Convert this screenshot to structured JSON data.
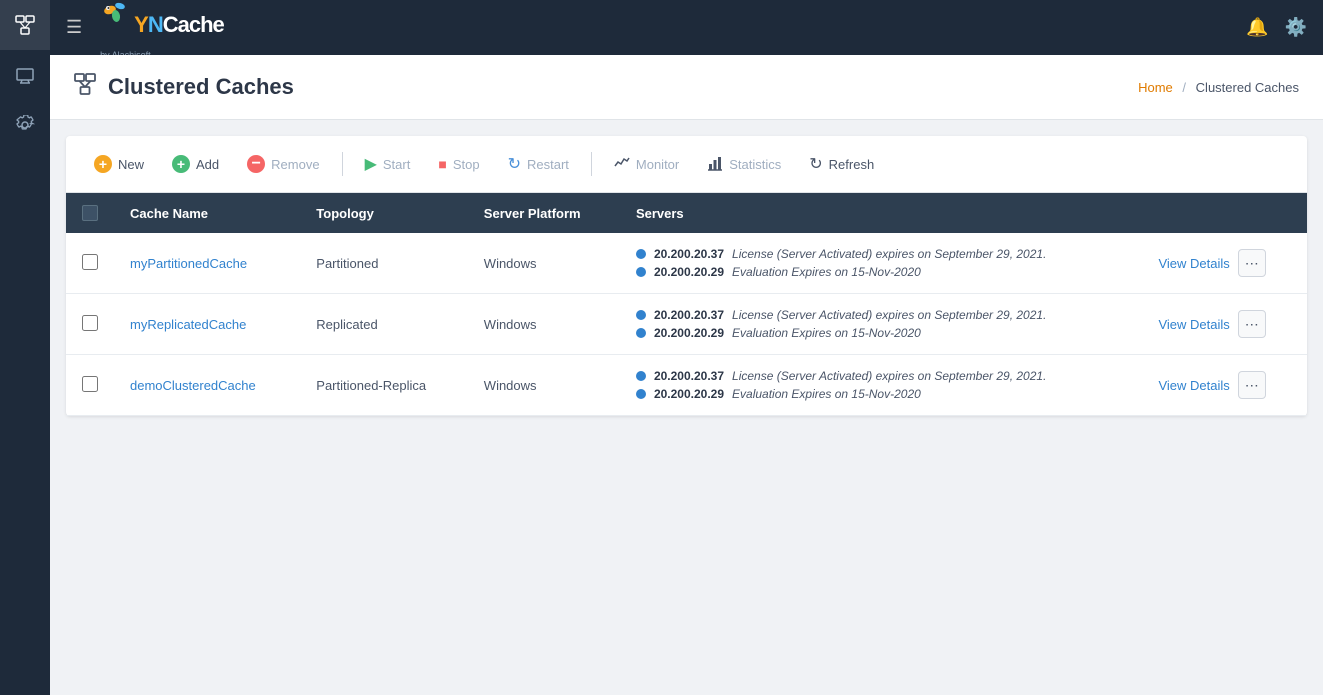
{
  "app": {
    "name": "NCache",
    "tagline": "by Alachisoft",
    "title": "Clustered Caches"
  },
  "breadcrumb": {
    "home": "Home",
    "separator": "/",
    "current": "Clustered Caches"
  },
  "toolbar": {
    "new_label": "New",
    "add_label": "Add",
    "remove_label": "Remove",
    "start_label": "Start",
    "stop_label": "Stop",
    "restart_label": "Restart",
    "monitor_label": "Monitor",
    "statistics_label": "Statistics",
    "refresh_label": "Refresh"
  },
  "table": {
    "columns": [
      "Cache Name",
      "Topology",
      "Server Platform",
      "Servers"
    ],
    "rows": [
      {
        "name": "myPartitionedCache",
        "topology": "Partitioned",
        "platform": "Windows",
        "servers": [
          {
            "ip": "20.200.20.37",
            "license": "License (Server Activated) expires on September 29, 2021."
          },
          {
            "ip": "20.200.20.29",
            "license": "Evaluation Expires on 15-Nov-2020"
          }
        ],
        "view_details": "View Details"
      },
      {
        "name": "myReplicatedCache",
        "topology": "Replicated",
        "platform": "Windows",
        "servers": [
          {
            "ip": "20.200.20.37",
            "license": "License (Server Activated) expires on September 29, 2021."
          },
          {
            "ip": "20.200.20.29",
            "license": "Evaluation Expires on 15-Nov-2020"
          }
        ],
        "view_details": "View Details"
      },
      {
        "name": "demoClusteredCache",
        "topology": "Partitioned-Replica",
        "platform": "Windows",
        "servers": [
          {
            "ip": "20.200.20.37",
            "license": "License (Server Activated) expires on September 29, 2021."
          },
          {
            "ip": "20.200.20.29",
            "license": "Evaluation Expires on 15-Nov-2020"
          }
        ],
        "view_details": "View Details"
      }
    ]
  },
  "sidebar": {
    "items": [
      {
        "icon": "⊞",
        "label": "Clustered Caches",
        "name": "clustered-caches"
      },
      {
        "icon": "🖥",
        "label": "Client Nodes",
        "name": "client-nodes"
      },
      {
        "icon": "🔧",
        "label": "Settings",
        "name": "settings"
      }
    ]
  },
  "colors": {
    "accent_blue": "#3182ce",
    "accent_orange": "#e07b00",
    "header_bg": "#1e2a3a",
    "table_header_bg": "#2d3e50",
    "server_dot": "#3182ce"
  }
}
